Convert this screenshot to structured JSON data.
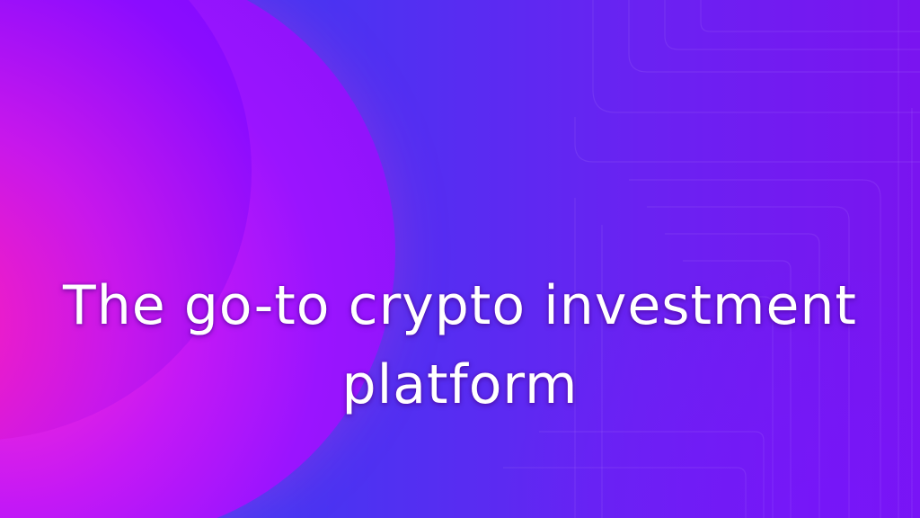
{
  "hero": {
    "headline": "The go-to crypto investment platform"
  },
  "colors": {
    "background_left": "#3a3cf4",
    "background_right": "#7a14f0",
    "orb_pink": "#ff2bd0",
    "orb_purple": "#8612f8",
    "text": "#ffffff"
  },
  "decorations": {
    "orb": "gradient-circle",
    "pattern": "circuit-lines"
  }
}
